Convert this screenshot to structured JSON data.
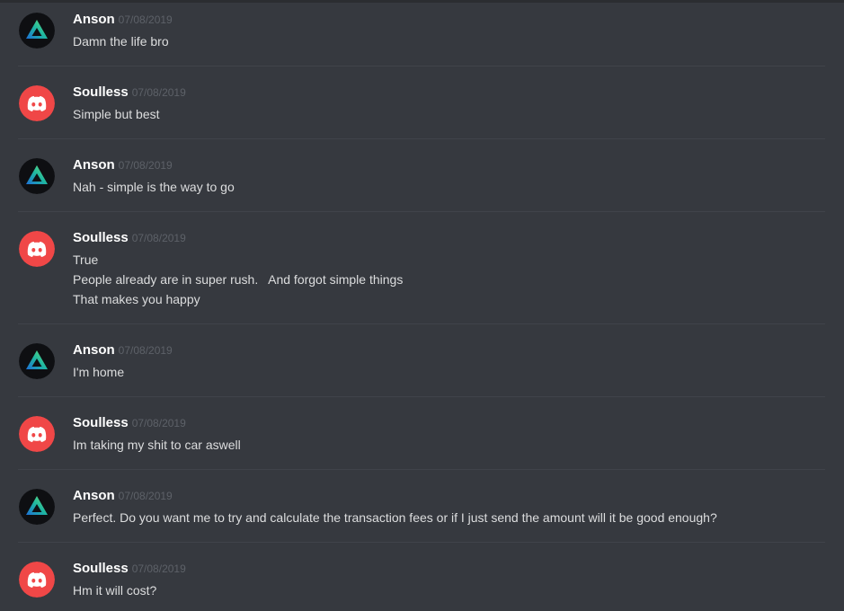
{
  "messages": [
    {
      "author": "Anson",
      "avatar": "gradient-triangle-logo-icon",
      "timestamp": "07/08/2019",
      "lines": [
        "Damn the life bro"
      ]
    },
    {
      "author": "Soulless",
      "avatar": "discord-logo-icon",
      "timestamp": "07/08/2019",
      "lines": [
        "Simple but best"
      ]
    },
    {
      "author": "Anson",
      "avatar": "gradient-triangle-logo-icon",
      "timestamp": "07/08/2019",
      "lines": [
        "Nah - simple is the way to go"
      ]
    },
    {
      "author": "Soulless",
      "avatar": "discord-logo-icon",
      "timestamp": "07/08/2019",
      "lines": [
        "True",
        "People already are in super rush.   And forgot simple things",
        "That makes you happy"
      ]
    },
    {
      "author": "Anson",
      "avatar": "gradient-triangle-logo-icon",
      "timestamp": "07/08/2019",
      "lines": [
        "I'm home"
      ]
    },
    {
      "author": "Soulless",
      "avatar": "discord-logo-icon",
      "timestamp": "07/08/2019",
      "lines": [
        "Im taking my shit to car aswell"
      ]
    },
    {
      "author": "Anson",
      "avatar": "gradient-triangle-logo-icon",
      "timestamp": "07/08/2019",
      "lines": [
        "Perfect. Do you want me to try and calculate the transaction fees or if I just send the amount will it be good enough?"
      ]
    },
    {
      "author": "Soulless",
      "avatar": "discord-logo-icon",
      "timestamp": "07/08/2019",
      "lines": [
        "Hm it will cost?"
      ]
    }
  ],
  "colors": {
    "background": "#36393f",
    "author": "#ffffff",
    "timestamp": "#5d6168",
    "message_text": "#dcddde",
    "discord_red": "#f04747",
    "anson_avatar_bg": "#0e0f12"
  }
}
